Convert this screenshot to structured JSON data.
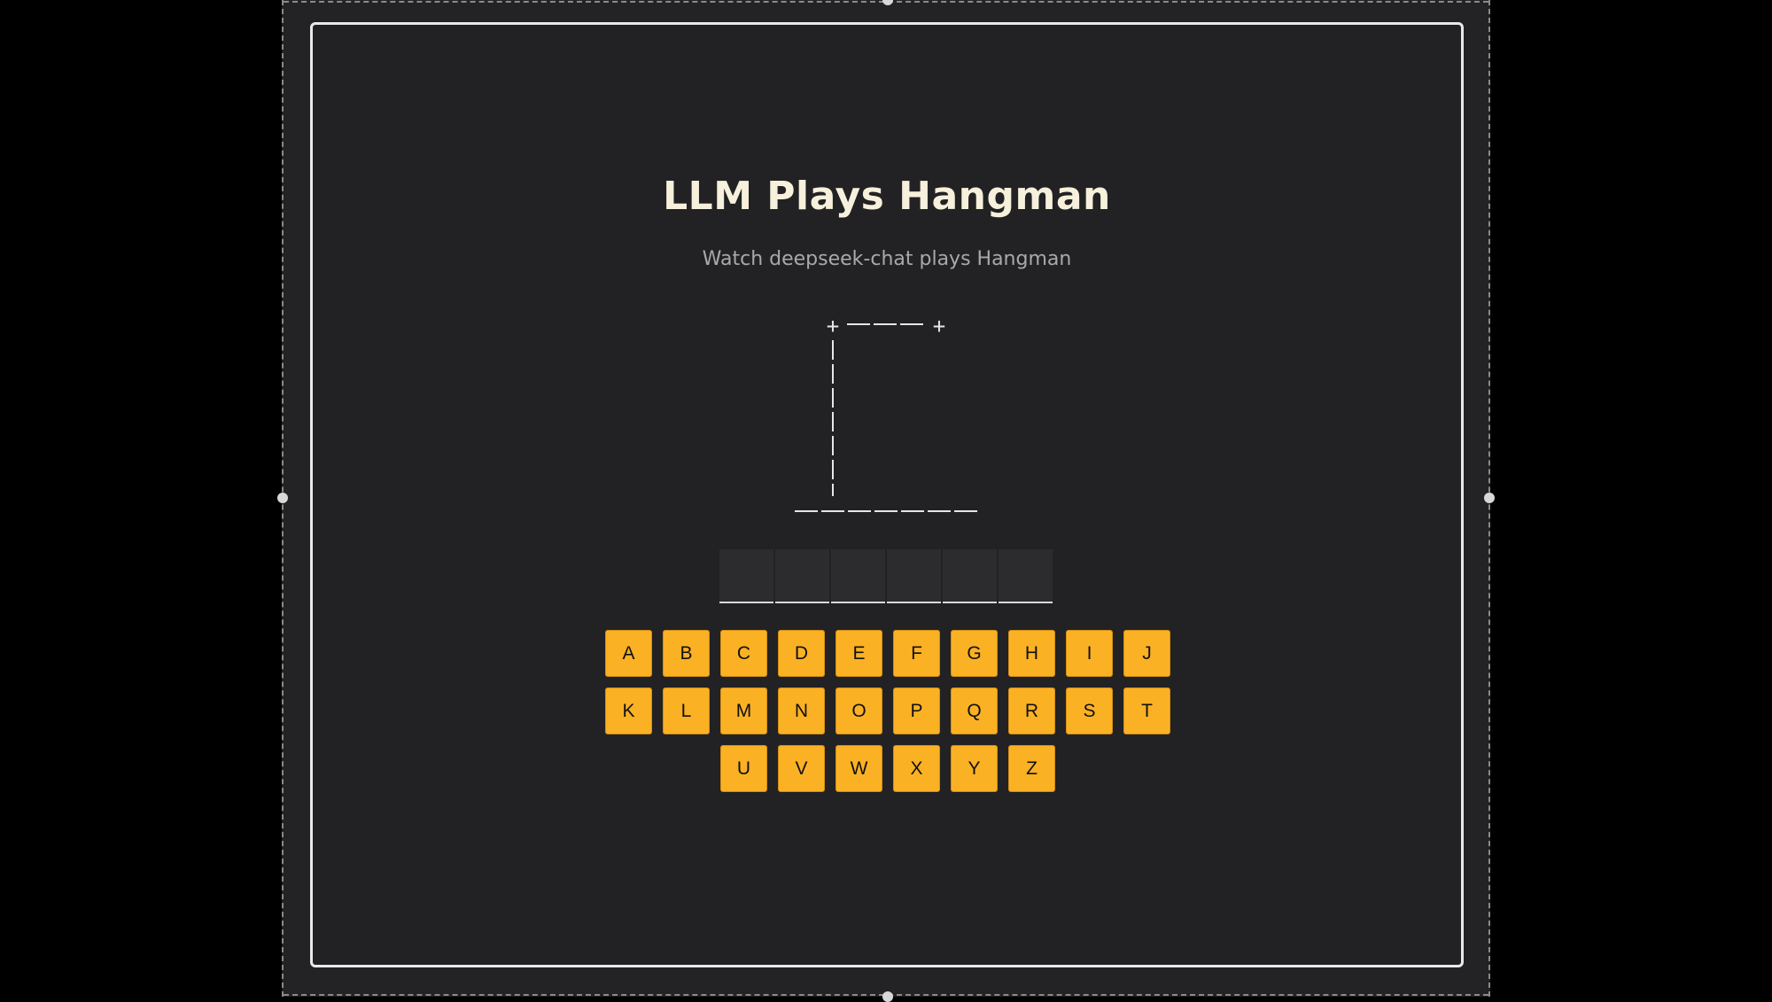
{
  "app": {
    "title": "LLM Plays Hangman",
    "subtitle": "Watch deepseek-chat plays Hangman"
  },
  "gallows": {
    "top_line": "+ ——— +",
    "corner_left": "+",
    "corner_right": "+",
    "base": "———————"
  },
  "word": {
    "slots": [
      "",
      "",
      "",
      "",
      "",
      ""
    ]
  },
  "keyboard": {
    "rows": [
      [
        "A",
        "B",
        "C",
        "D",
        "E",
        "F",
        "G",
        "H",
        "I",
        "J"
      ],
      [
        "K",
        "L",
        "M",
        "N",
        "O",
        "P",
        "Q",
        "R",
        "S",
        "T"
      ],
      [
        "U",
        "V",
        "W",
        "X",
        "Y",
        "Z"
      ]
    ],
    "key_color": "#fbb124"
  },
  "colors": {
    "background": "#222224",
    "title": "#f6f0dc",
    "subtitle": "#a9a9a9",
    "card_border": "#e9e9e9"
  }
}
